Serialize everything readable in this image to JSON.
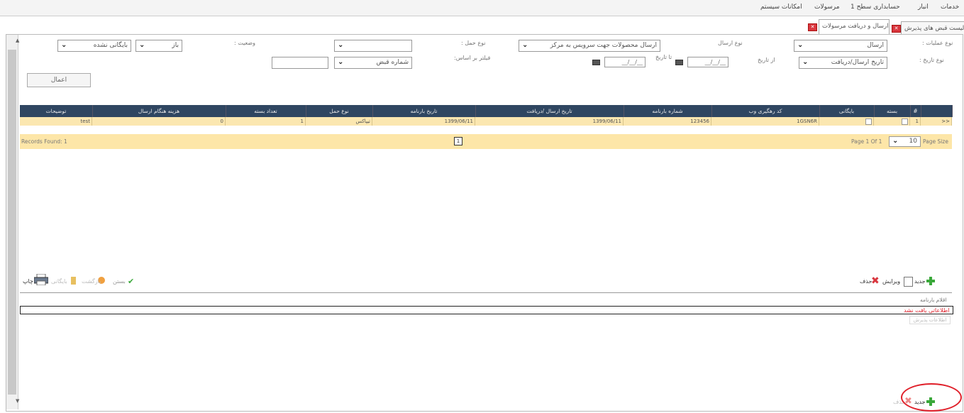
{
  "menu": {
    "items": [
      "خدمات",
      "انبار",
      "حسابداری سطح 1",
      "مرسولات",
      "امکانات سیستم"
    ]
  },
  "tabs": [
    {
      "label": "لیست قبض های پذیرش"
    },
    {
      "label": "ارسال و دریافت مرسولات"
    }
  ],
  "form": {
    "op_type_label": "نوع عملیات :",
    "op_type_value": "ارسال",
    "send_type_label": "نوع ارسال",
    "send_type_value": "ارسال محصولات جهت سرویس به مرکز",
    "carry_type_label": "نوع حمل :",
    "carry_type_value": "",
    "status_label": "وضعیت :",
    "status_value": "باز",
    "archive_value": "بایگانی نشده",
    "date_type_label": "نوع تاریخ :",
    "date_type_value": "تاریخ ارسال/دریافت",
    "from_date_label": "از تاریخ",
    "from_date_value": "__/__/__",
    "to_date_label": "تا تاریخ",
    "to_date_value": "__/__/__",
    "filter_label": "فیلتر بر اساس:",
    "filter_value": "شماره قبض",
    "filter_text": "",
    "apply_label": "اعمال"
  },
  "grid": {
    "columns": [
      "#",
      "بسته",
      "بایگانی",
      "کد رهگیری وب",
      "شماره بارنامه",
      "تاریخ ارسال /دریافت",
      "تاریخ بارنامه",
      "نوع حمل",
      "تعداد بسته",
      "هزینه هنگام ارسال",
      "توضیحات"
    ],
    "rows": [
      {
        "expand": ">>",
        "num": "1",
        "tracking": "1GSN6R",
        "waybill": "123456",
        "send_date": "1399/06/11",
        "waybill_date": "1399/06/11",
        "carry": "تیپاکس",
        "count": "1",
        "cost": "0",
        "desc": "test"
      }
    ],
    "records_found": "Records Found: 1",
    "page_number": "1",
    "page_of": "Page 1 Of 1",
    "page_size_value": "10",
    "page_size_label": "Page Size"
  },
  "toolbar_top_right": {
    "new": "جدید",
    "edit": "ویرایش",
    "delete": "حذف"
  },
  "toolbar_top_left": {
    "close": "بستن",
    "reopen": "بازگشت",
    "archive": "بایگانی",
    "print": "چاپ"
  },
  "items_section": {
    "title": "اقلام بارنامه",
    "not_found": "اطلاعاتی یافت نشد",
    "receipt_info": "اطلاعات پذیرش"
  },
  "toolbar_bottom": {
    "new": "جدید",
    "delete": "حذف"
  },
  "colors": {
    "header": "#2f4661",
    "row": "#fbe7b0",
    "footer": "#fde6a8",
    "accent_red": "#e0202a",
    "add_green": "#3aa83a"
  }
}
